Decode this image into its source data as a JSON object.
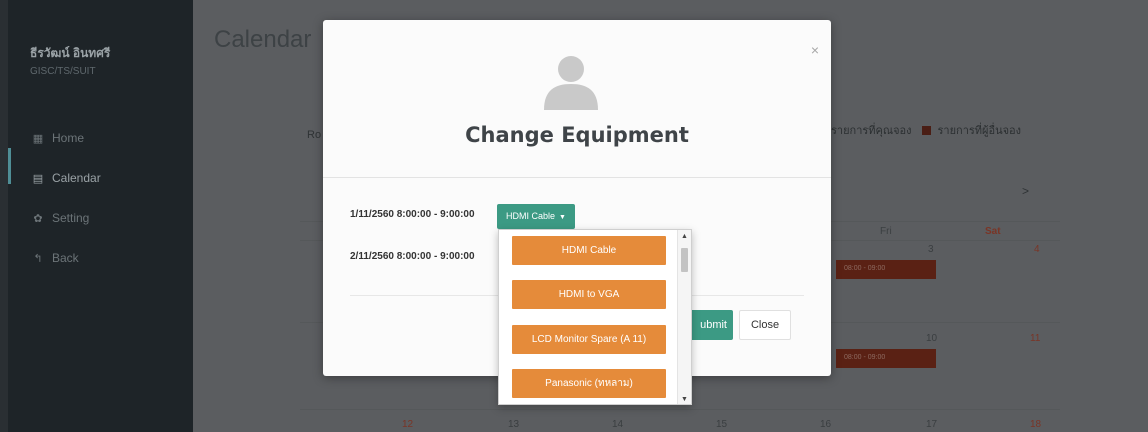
{
  "sidebar": {
    "user_name": "ธีรวัฒน์ อินทศรี",
    "user_dept": "GISC/TS/SUIT",
    "items": [
      {
        "label": "Home",
        "icon": "grid-icon"
      },
      {
        "label": "Calendar",
        "icon": "calendar-icon"
      },
      {
        "label": "Setting",
        "icon": "gear-icon"
      },
      {
        "label": "Back",
        "icon": "reply-icon"
      }
    ]
  },
  "background": {
    "page_title": "Calendar",
    "room_label": "Ro",
    "legend": [
      {
        "label": "รายการที่คุณจอง"
      },
      {
        "label": "รายการที่ผู้อื่นจอง"
      }
    ],
    "next_arrow": ">",
    "day_headers": [
      "Fri",
      "Sat"
    ],
    "dates": [
      "3",
      "4",
      "10",
      "11",
      "12",
      "13",
      "14",
      "15",
      "16",
      "17",
      "18"
    ],
    "events": [
      "08:00 - 09:00",
      "08:00 - 09:00"
    ]
  },
  "modal": {
    "title": "Change Equipment",
    "close_symbol": "×",
    "slots": [
      {
        "time": "1/11/2560 8:00:00 - 9:00:00"
      },
      {
        "time": "2/11/2560 8:00:00 - 9:00:00"
      }
    ],
    "equipment_selected": "HDMI Cable",
    "submit_label": "Submit",
    "submit_visible_label": "ubmit",
    "close_label": "Close"
  },
  "dropdown": {
    "options": [
      "HDMI Cable",
      "HDMI to VGA",
      "LCD Monitor Spare (A 11)",
      "Panasonic (ทหลาม)"
    ]
  },
  "colors": {
    "sidebar_bg": "#1e2428",
    "accent_green": "#3c9a84",
    "option_orange": "#e58b3a",
    "event_brown": "#5a2114"
  }
}
